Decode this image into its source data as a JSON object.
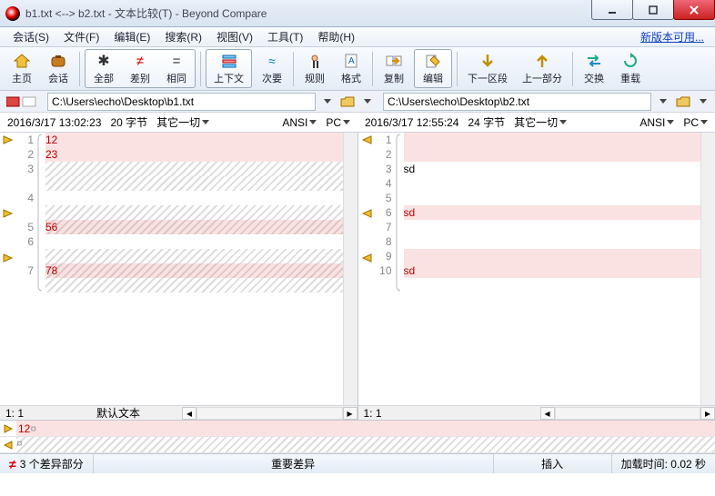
{
  "window": {
    "title": "b1.txt <--> b2.txt - 文本比较(T) - Beyond Compare"
  },
  "menus": [
    "会话(S)",
    "文件(F)",
    "编辑(E)",
    "搜索(R)",
    "视图(V)",
    "工具(T)",
    "帮助(H)"
  ],
  "new_version": "新版本可用...",
  "toolbar": {
    "home": "主页",
    "session": "会话",
    "all": "全部",
    "diffs": "差别",
    "same": "相同",
    "context": "上下文",
    "minor": "次要",
    "rules": "规则",
    "format": "格式",
    "copy": "复制",
    "edit": "编辑",
    "next_section": "下一区段",
    "prev_section": "上一部分",
    "swap": "交换",
    "reload": "重载"
  },
  "left": {
    "path": "C:\\Users\\echo\\Desktop\\b1.txt",
    "timestamp": "2016/3/17 13:02:23",
    "size": "20 字节",
    "everything": "其它一切",
    "encoding": "ANSI",
    "lineend": "PC",
    "lines": [
      {
        "n": 1,
        "text": "12",
        "kind": "diff",
        "marker": "right"
      },
      {
        "n": 2,
        "text": "23",
        "kind": "diff"
      },
      {
        "n": 3,
        "text": "",
        "kind": "hatch"
      },
      {
        "n": "",
        "text": "",
        "kind": "hatch"
      },
      {
        "n": 4,
        "text": "",
        "kind": "plain"
      },
      {
        "n": "",
        "text": "",
        "kind": "hatch",
        "marker": "right"
      },
      {
        "n": 5,
        "text": "56",
        "kind": "hatchdiff"
      },
      {
        "n": 6,
        "text": "",
        "kind": "plain"
      },
      {
        "n": "",
        "text": "",
        "kind": "hatch",
        "marker": "right"
      },
      {
        "n": 7,
        "text": "78",
        "kind": "hatchdiff"
      },
      {
        "n": "",
        "text": "",
        "kind": "hatch"
      }
    ],
    "cursor": "1: 1",
    "mode": "默认文本"
  },
  "right": {
    "path": "C:\\Users\\echo\\Desktop\\b2.txt",
    "timestamp": "2016/3/17 12:55:24",
    "size": "24 字节",
    "everything": "其它一切",
    "encoding": "ANSI",
    "lineend": "PC",
    "lines": [
      {
        "n": 1,
        "text": "",
        "kind": "diff",
        "marker": "left"
      },
      {
        "n": 2,
        "text": "",
        "kind": "diff"
      },
      {
        "n": 3,
        "text": "sd",
        "kind": "plain"
      },
      {
        "n": 4,
        "text": "",
        "kind": "plain"
      },
      {
        "n": 5,
        "text": "",
        "kind": "plain"
      },
      {
        "n": 6,
        "text": "sd",
        "kind": "diff",
        "marker": "left"
      },
      {
        "n": 7,
        "text": "",
        "kind": "plain"
      },
      {
        "n": 8,
        "text": "",
        "kind": "plain"
      },
      {
        "n": 9,
        "text": "",
        "kind": "diff",
        "marker": "left"
      },
      {
        "n": 10,
        "text": "sd",
        "kind": "diff"
      },
      {
        "n": "",
        "text": "",
        "kind": "plain"
      }
    ],
    "cursor": "1: 1"
  },
  "detail": {
    "line1": "12",
    "symbol": "¤"
  },
  "status": {
    "diff_count": "3 个差异部分",
    "important": "重要差异",
    "insert": "插入",
    "load_time": "加载时间: 0.02 秒"
  }
}
